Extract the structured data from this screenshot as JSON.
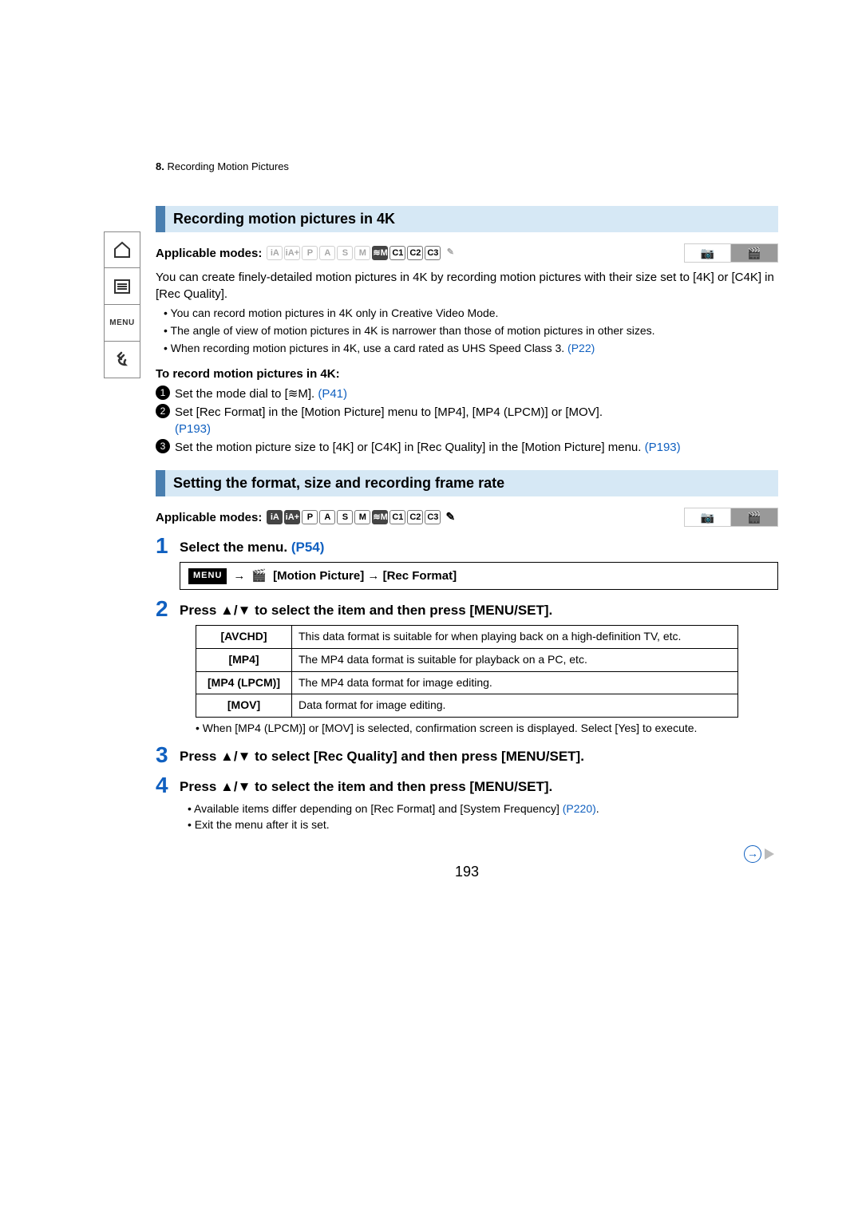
{
  "header": {
    "section_num": "8.",
    "section_title": "Recording Motion Pictures"
  },
  "sidebar": {
    "home": "⌂",
    "toc": "≣",
    "menu": "MENU",
    "back": "↶"
  },
  "sec1": {
    "heading": "Recording motion pictures in 4K",
    "applicable_label": "Applicable modes:",
    "modes": [
      "iA",
      "iA+",
      "P",
      "A",
      "S",
      "M",
      "≋M",
      "C1",
      "C2",
      "C3",
      "✎"
    ],
    "tab_photo": "◉",
    "tab_video": "▰",
    "intro": "You can create finely-detailed motion pictures in 4K by recording motion pictures with their size set to [4K] or [C4K] in [Rec Quality].",
    "bullets": [
      "You can record motion pictures in 4K only in Creative Video Mode.",
      "The angle of view of motion pictures in 4K is narrower than those of motion pictures in other sizes.",
      "When recording motion pictures in 4K, use a card rated as UHS Speed Class 3."
    ],
    "bullet3_link": "(P22)",
    "subhead": "To record motion pictures in 4K:",
    "steps": [
      {
        "text": "Set the mode dial to [≋M].",
        "link": "(P41)"
      },
      {
        "text": "Set [Rec Format] in the [Motion Picture] menu to [MP4], [MP4 (LPCM)] or [MOV].",
        "link": "(P193)"
      },
      {
        "text": "Set the motion picture size to [4K] or [C4K] in [Rec Quality] in the [Motion Picture] menu.",
        "link": "(P193)"
      }
    ]
  },
  "sec2": {
    "heading": "Setting the format, size and recording frame rate",
    "applicable_label": "Applicable modes:",
    "modes": [
      "iA",
      "iA+",
      "P",
      "A",
      "S",
      "M",
      "≋M",
      "C1",
      "C2",
      "C3",
      "✎"
    ],
    "steps": {
      "s1_text": "Select the menu.",
      "s1_link": "(P54)",
      "menu_badge": "MENU",
      "menu_arrow": "→",
      "menu_path": "[Motion Picture] → [Rec Format]",
      "s2_text": "Press ▲/▼ to select the item and then press [MENU/SET].",
      "s3_text": "Press ▲/▼ to select [Rec Quality] and then press [MENU/SET].",
      "s4_text": "Press ▲/▼ to select the item and then press [MENU/SET]."
    },
    "formats": [
      {
        "name": "[AVCHD]",
        "desc": "This data format is suitable for when playing back on a high-definition TV, etc."
      },
      {
        "name": "[MP4]",
        "desc": "The MP4 data format is suitable for playback on a PC, etc."
      },
      {
        "name": "[MP4 (LPCM)]",
        "desc": "The MP4 data format for image editing."
      },
      {
        "name": "[MOV]",
        "desc": "Data format for image editing."
      }
    ],
    "after_table": [
      "When [MP4 (LPCM)] or [MOV] is selected, confirmation screen is displayed. Select [Yes] to execute."
    ],
    "s4_bullets_prefix": "Available items differ depending on [Rec Format] and [System Frequency]",
    "s4_bullets_link": "(P220)",
    "s4_bullets_suffix": ".",
    "s4_bullet2": "Exit the menu after it is set."
  },
  "page_number": "193"
}
